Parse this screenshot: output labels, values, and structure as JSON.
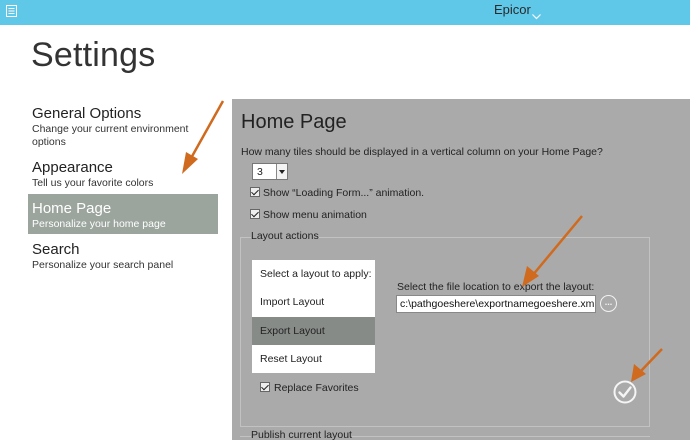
{
  "titlebar": {
    "title": "Epicor"
  },
  "page_title": "Settings",
  "sidebar": {
    "items": [
      {
        "title": "General Options",
        "desc": "Change your current environment options"
      },
      {
        "title": "Appearance",
        "desc": "Tell us your favorite colors"
      },
      {
        "title": "Home Page",
        "desc": "Personalize your home page",
        "active": true
      },
      {
        "title": "Search",
        "desc": "Personalize your search panel"
      }
    ]
  },
  "home_page": {
    "title": "Home Page",
    "tiles_question": "How many tiles should be displayed in a vertical column on your Home Page?",
    "tiles_value": "3",
    "show_loading_label": "Show “Loading Form...” animation.",
    "show_menu_label": "Show menu animation",
    "show_loading_checked": true,
    "show_menu_checked": true
  },
  "layout_actions": {
    "group_label": "Layout actions",
    "list": [
      "Select a layout to apply:",
      "Import Layout",
      "Export Layout",
      "Reset Layout"
    ],
    "selected": "Export Layout",
    "export_prompt": "Select the file location to export the layout:",
    "export_path": "c:\\pathgoeshere\\exportnamegoeshere.xml",
    "browse_label": "...",
    "replace_favorites_label": "Replace Favorites",
    "replace_favorites_checked": true
  },
  "publish": {
    "label": "Publish current layout"
  },
  "colors": {
    "titlebar": "#5fc7e8",
    "panel": "#aaaaaa",
    "nav_active": "#9ba59e",
    "list_selected": "#878b88",
    "annotation_arrow": "#d06a1e"
  },
  "icons": [
    "app-icon",
    "chevron-down-icon",
    "checkbox-checked-icon",
    "ellipsis-icon",
    "checkmark-circle-icon",
    "arrow-annotation"
  ]
}
